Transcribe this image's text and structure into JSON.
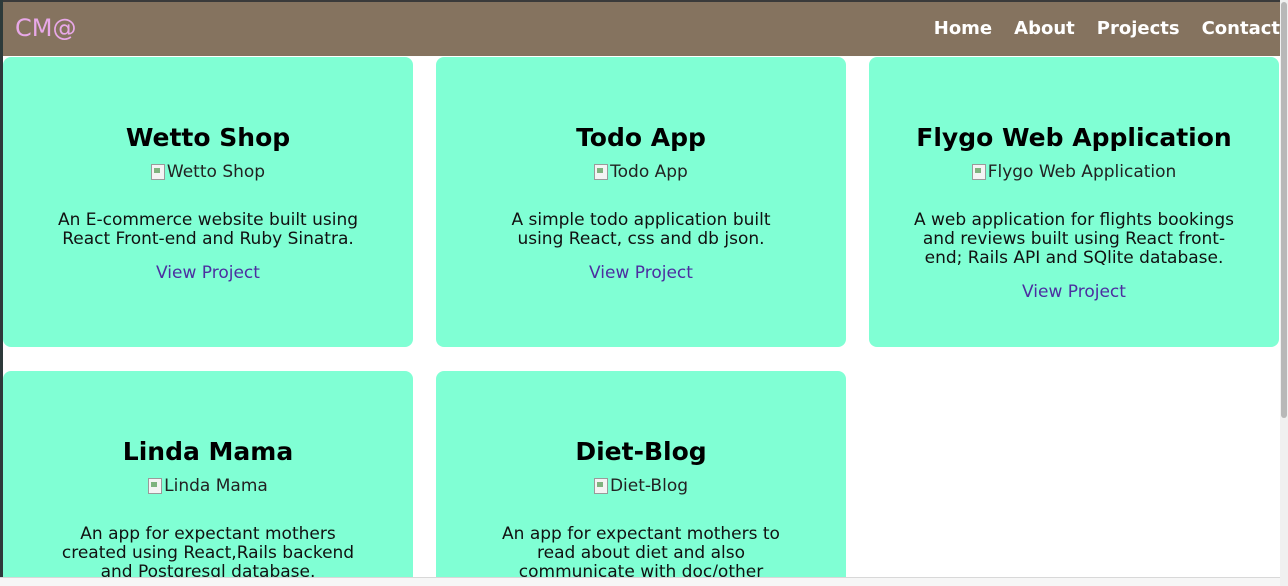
{
  "brand": "CM@",
  "nav": {
    "items": [
      "Home",
      "About",
      "Projects",
      "Contact"
    ]
  },
  "projects": [
    {
      "title": "Wetto Shop",
      "img_alt": "Wetto Shop",
      "description": "An E-commerce website built using React Front-end and Ruby Sinatra.",
      "link": "View Project"
    },
    {
      "title": "Todo App",
      "img_alt": "Todo App",
      "description": "A simple todo application built using React, css and db json.",
      "link": "View Project"
    },
    {
      "title": "Flygo Web Application",
      "img_alt": "Flygo Web Application",
      "description": "A web application for flights bookings and reviews built using React front-end; Rails API and SQlite database.",
      "link": "View Project"
    },
    {
      "title": "Linda Mama",
      "img_alt": "Linda Mama",
      "description": "An app for expectant mothers created using React,Rails backend and Postgresql database."
    },
    {
      "title": "Diet-Blog",
      "img_alt": "Diet-Blog",
      "description": "An app for expectant mothers to read about diet and also communicate with doc/other mothers through a chat"
    }
  ],
  "colors": {
    "navbar": "#85735f",
    "brand": "#e8a8e8",
    "card": "#80ffd4",
    "link": "#4c2ea0"
  }
}
